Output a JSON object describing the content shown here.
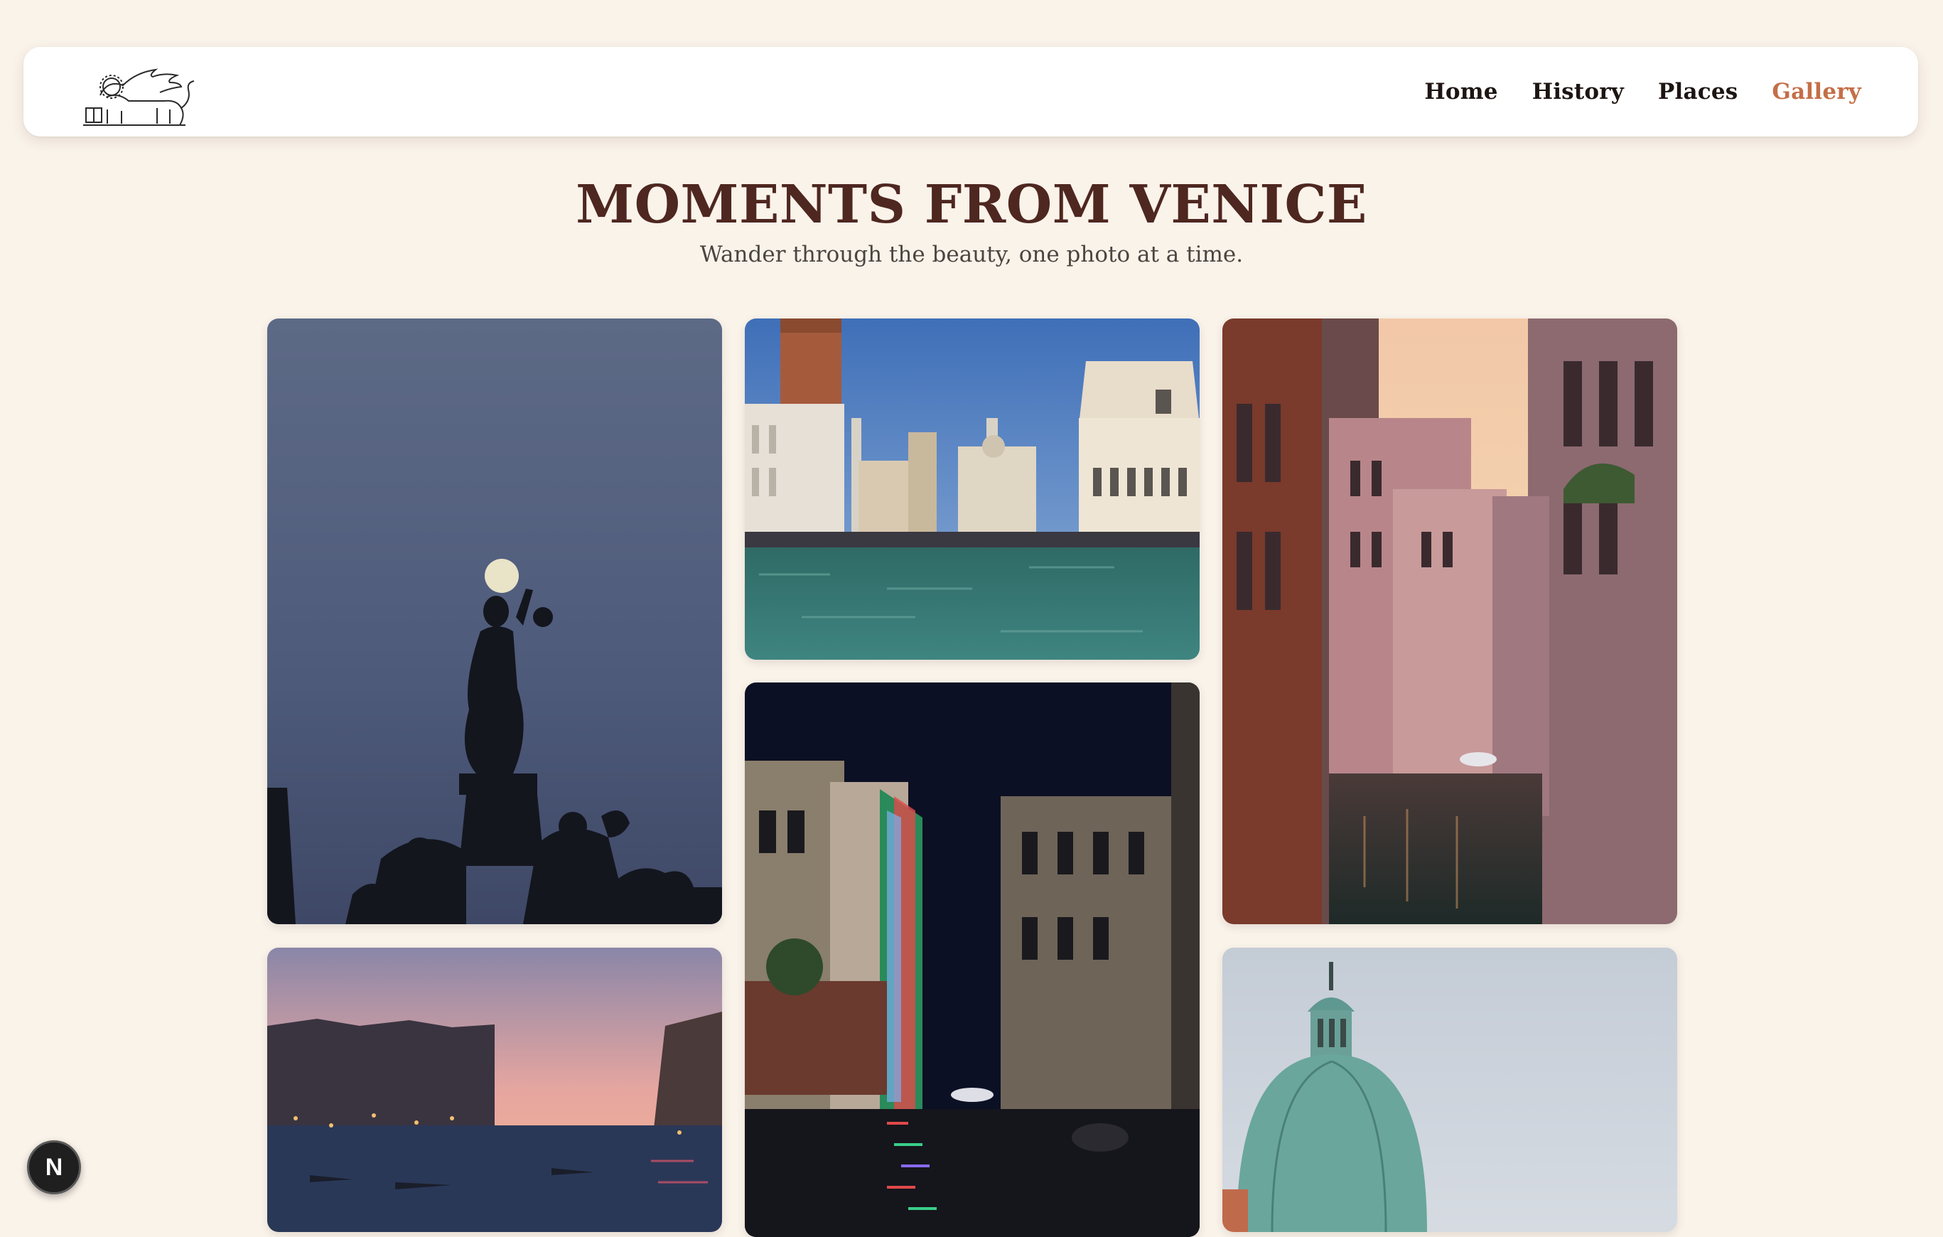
{
  "nav": {
    "logo_alt": "Winged lion of Saint Mark",
    "links": [
      {
        "label": "Home"
      },
      {
        "label": "History"
      },
      {
        "label": "Places"
      },
      {
        "label": "Gallery",
        "active": true
      }
    ]
  },
  "hero": {
    "title": "MOMENTS FROM VENICE",
    "subtitle": "Wander through the beauty, one photo at a time."
  },
  "gallery": {
    "photos": [
      {
        "subject": "statue-silhouette-with-moon"
      },
      {
        "subject": "piazza-san-marco-from-water"
      },
      {
        "subject": "canal-at-sunset"
      },
      {
        "subject": "canal-at-night-with-lights"
      },
      {
        "subject": "grand-canal-at-dusk"
      },
      {
        "subject": "green-dome-church"
      }
    ]
  },
  "dev_badge": {
    "label": "N"
  },
  "colors": {
    "background": "#faf3ea",
    "title": "#4e2720",
    "nav_active": "#c46e47",
    "nav_text": "#1d1512"
  }
}
